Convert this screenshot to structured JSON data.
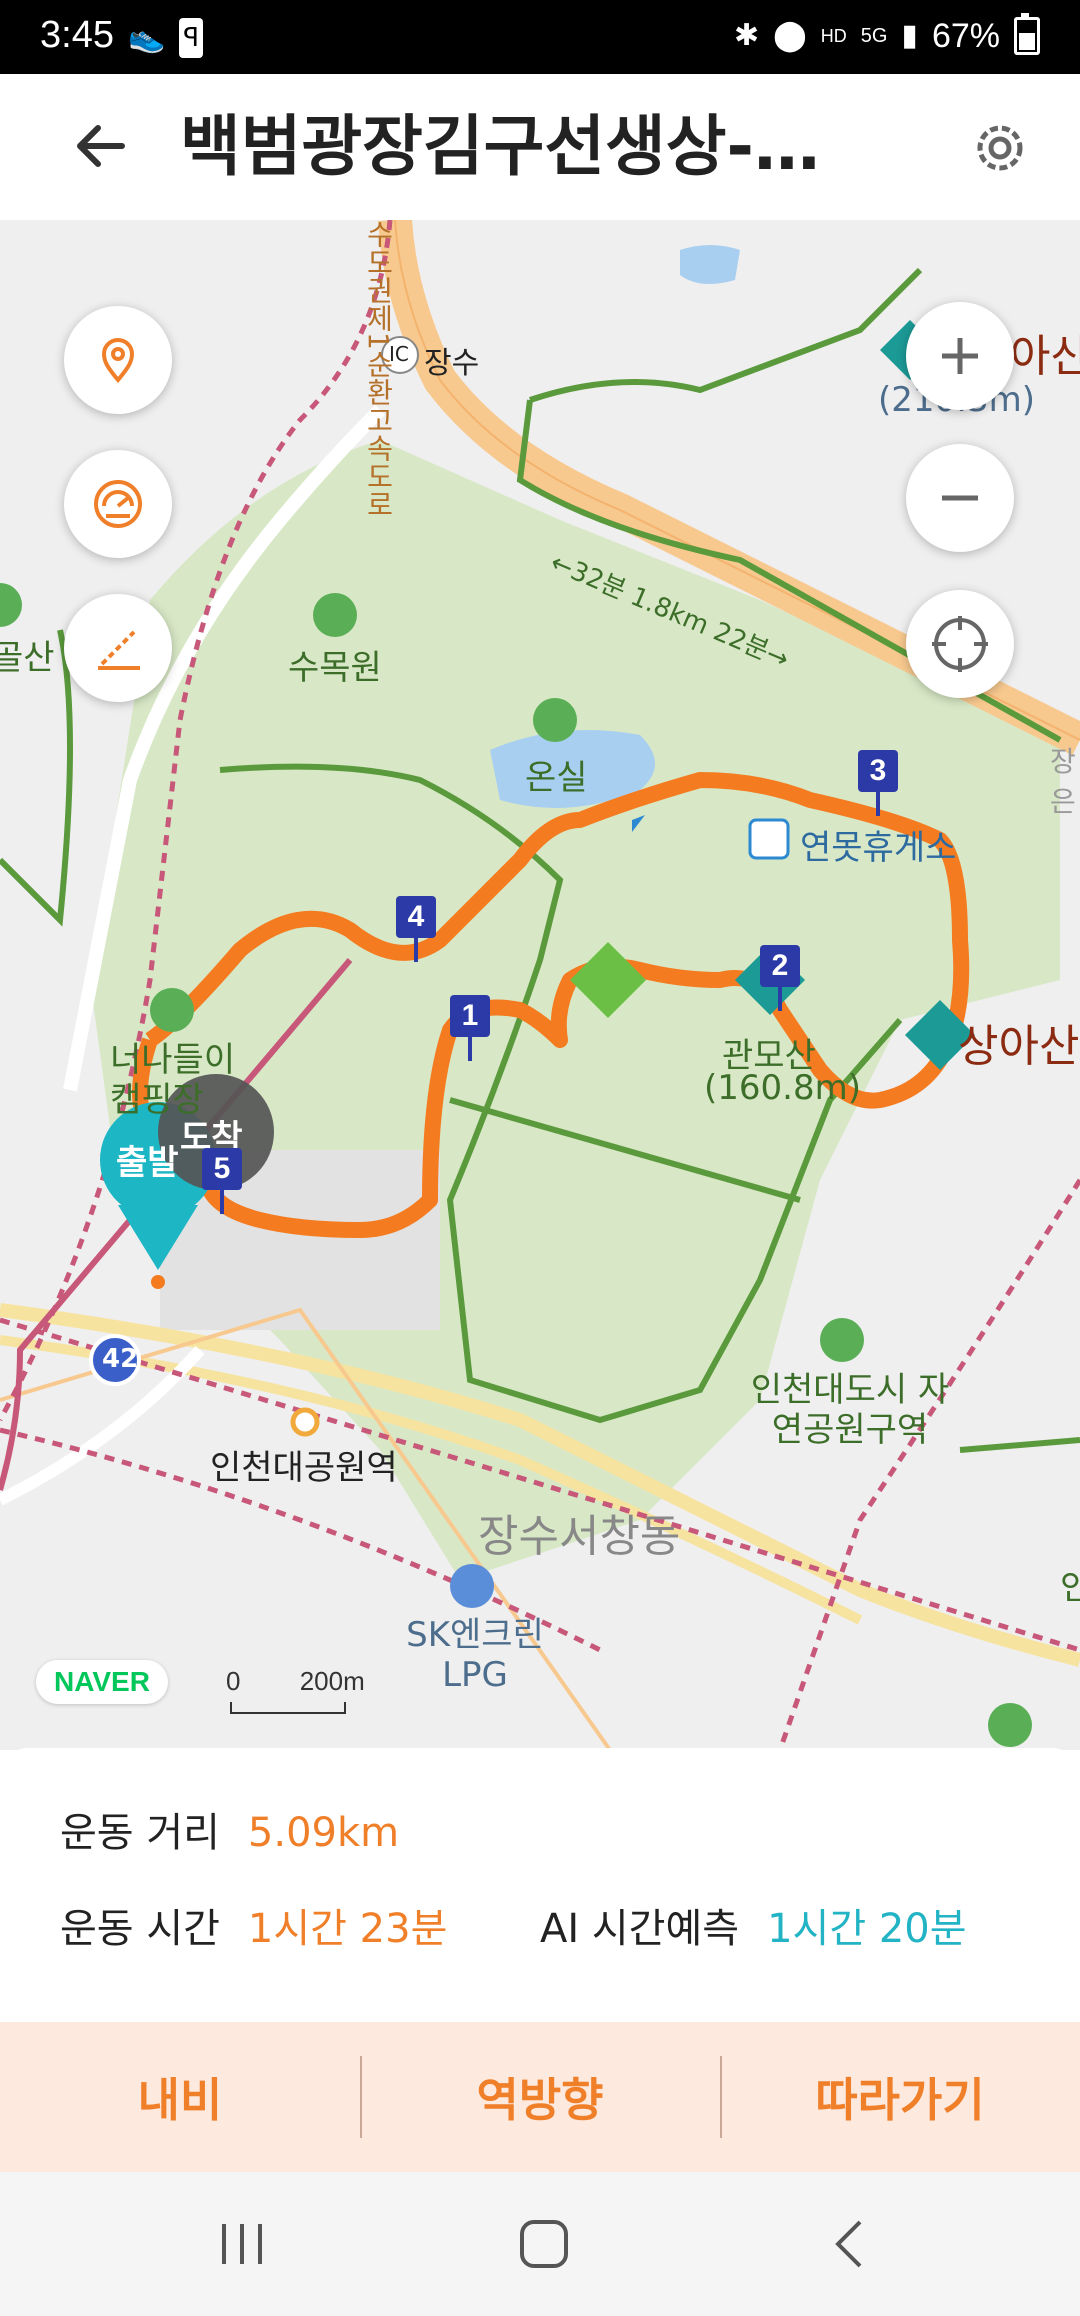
{
  "status_bar": {
    "time": "3:45",
    "battery": "67%",
    "battery_level": 0.67,
    "icons": [
      "shoe-icon",
      "app-icon",
      "bluetooth-icon",
      "location-icon",
      "hd-voice-icon",
      "5g-icon",
      "signal-icon",
      "battery-icon"
    ]
  },
  "header": {
    "title": "백범광장김구선생상-인…"
  },
  "map": {
    "labels": {
      "road_highway": "수도권제1순환고속도로",
      "ic": "IC",
      "ic_name": "장수",
      "route_info": "←32분 1.8km 22분→",
      "peak_top_right": "아산",
      "peak_top_right_height": "(210.3m)",
      "left_mountain": "골산",
      "arboretum": "수목원",
      "greenhouse": "온실",
      "rest_area": "연못휴게소",
      "camping": "너나들이 캠핑장",
      "gwanbosan": "관모산",
      "gwanbosan_height": "(160.8m)",
      "sangasan": "상아산",
      "edge_right": "장은",
      "park_area": "인천대도시 자연공원구역",
      "station": "인천대공원역",
      "district": "장수서창동",
      "gas_station": "SK엔크린 LPG",
      "route_number": "42",
      "edge_right_bottom": "인"
    },
    "markers": [
      "1",
      "2",
      "3",
      "4",
      "5"
    ],
    "start_label": "출발",
    "end_label": "도착",
    "naver_logo": "NAVER",
    "scale_zero": "0",
    "scale_label": "200m",
    "colors": {
      "route": "#f47b20",
      "park": "#d8e8c6",
      "trail": "#5a9a3c",
      "highway": "#f8c98f",
      "marker": "#2c3aa8",
      "start": "#1cb6c4"
    }
  },
  "stats": {
    "distance_label": "운동 거리",
    "distance_value": "5.09km",
    "time_label": "운동 시간",
    "time_value": "1시간 23분",
    "ai_label": "AI 시간예측",
    "ai_value": "1시간 20분"
  },
  "actions": {
    "navigate": "내비",
    "reverse": "역방향",
    "follow": "따라가기"
  }
}
